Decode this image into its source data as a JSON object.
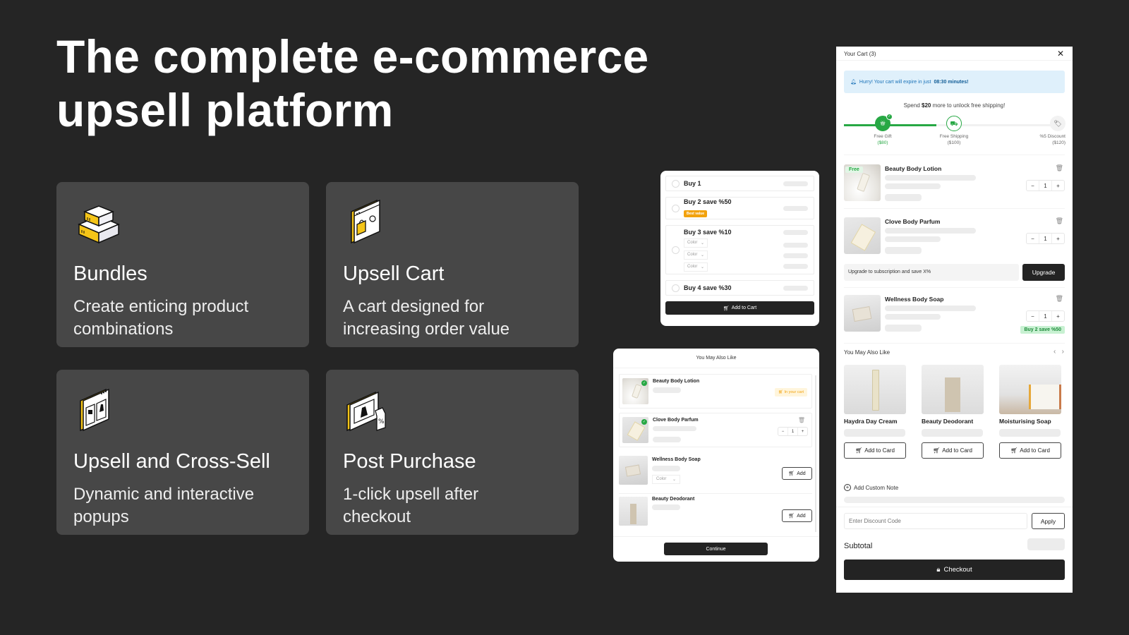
{
  "headline": {
    "line1": "The complete e-commerce",
    "line2": "upsell platform"
  },
  "features": [
    {
      "icon": "stacked-boxes-icon",
      "title": "Bundles",
      "desc_line1": "Create enticing product",
      "desc_line2": "combinations"
    },
    {
      "icon": "shopping-bag-window-icon",
      "title": "Upsell Cart",
      "desc_line1": "A cart designed for",
      "desc_line2": "increasing order value"
    },
    {
      "icon": "product-cards-window-icon",
      "title": "Upsell and Cross-Sell",
      "desc_line1": "Dynamic and interactive",
      "desc_line2": "popups"
    },
    {
      "icon": "discount-tag-window-icon",
      "title": "Post Purchase",
      "desc_line1": "1-click upsell after",
      "desc_line2": "checkout"
    }
  ],
  "bundle_widget": {
    "options": [
      {
        "label": "Buy 1"
      },
      {
        "label": "Buy 2 save %50",
        "badge": "Best value"
      },
      {
        "label": "Buy 3 save %10",
        "variant_selects": [
          "Color",
          "Color",
          "Color"
        ]
      },
      {
        "label": "Buy 4 save %30"
      }
    ],
    "add_to_cart": "Add to Cart"
  },
  "ymal_popup": {
    "title": "You May Also Like",
    "items": [
      {
        "name": "Beauty Body Lotion",
        "status": "In your cart"
      },
      {
        "name": "Clove Body Parfum",
        "quantity": "1"
      },
      {
        "name": "Wellness Body Soap",
        "select": "Color",
        "action": "Add"
      },
      {
        "name": "Beauty Deodorant",
        "action": "Add"
      }
    ],
    "continue": "Continue"
  },
  "cart": {
    "title": "Your Cart (3)",
    "timer": {
      "prefix": "Hurry! Your cart will expire in just",
      "time": "08:30 minutes!"
    },
    "spend": {
      "prefix": "Spend",
      "amount": "$20",
      "suffix": "more to unlock free shipping!"
    },
    "progress_fraction": 0.42,
    "milestones": [
      {
        "label": "Free Gift",
        "amount": "($80)",
        "reached": true
      },
      {
        "label": "Free Shipping",
        "amount": "($100)",
        "reached": false
      },
      {
        "label": "%5 Discount",
        "amount": "($120)",
        "reached": false
      }
    ],
    "items": [
      {
        "name": "Beauty Body Lotion",
        "tag": "Free",
        "quantity": "1"
      },
      {
        "name": "Clove Body Parfum",
        "quantity": "1"
      },
      {
        "name": "Wellness Body Soap",
        "quantity": "1",
        "promo": "Buy 2 save %50"
      }
    ],
    "upgrade": {
      "text": "Upgrade to subscription and save X%",
      "button": "Upgrade"
    },
    "recommendations": {
      "title": "You May Also Like",
      "products": [
        {
          "name": "Haydra Day Cream",
          "button": "Add to Card"
        },
        {
          "name": "Beauty Deodorant",
          "button": "Add to Card"
        },
        {
          "name": "Moisturising Soap",
          "button": "Add to Card"
        }
      ]
    },
    "custom_note": "Add Custom Note",
    "discount_placeholder": "Enter Discount Code",
    "apply": "Apply",
    "subtotal_label": "Subtotal",
    "checkout": "Checkout"
  },
  "colors": {
    "background": "#252525",
    "card": "#474747",
    "accent_yellow": "#f5c518",
    "success_green": "#27a844",
    "badge_orange": "#f2a20d",
    "dark_button": "#232323",
    "info_blue": "#1a72b8"
  }
}
